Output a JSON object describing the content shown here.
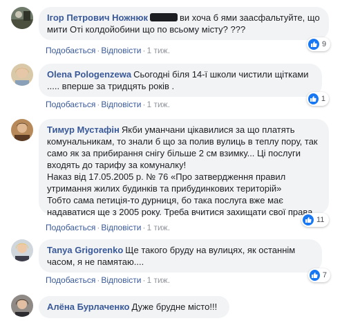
{
  "comments": [
    {
      "author": "Ігор Петрович Ножнюк",
      "text": "ви хоча б ями заасфальтуйте, що мити Оті колдойобини що по всьому місту? ???",
      "likes_count": "9",
      "action_like": "Подобається",
      "action_reply": "Відповісти",
      "time": "1 тиж."
    },
    {
      "author": "Olena Pologenzewa",
      "text": "Сьогодні біля 14-ї школи чистили щітками ..... вперше за тридцять років .",
      "likes_count": "1",
      "action_like": "Подобається",
      "action_reply": "Відповісти",
      "time": "1 тиж."
    },
    {
      "author": "Тимур Мустафін",
      "text": "Якби уманчани цікавилися за що платять комунальникам, то знали б що за полив вулиць в теплу пору, так само як за прибирання снігу більше 2 см взимку... Ці послуги входять до тарифу за комуналку!",
      "text2": "Наказ від 17.05.2005 р. № 76 «Про затвердження правил утримання жилих будинків та прибудинкових територій»",
      "text3": "Тобто сама петиція-то дурниця, бо така послуга вже має надаватися ще з 2005 року. Треба вчитися захищати свої права.",
      "likes_count": "11",
      "action_like": "Подобається",
      "action_reply": "Відповісти",
      "time": "1 тиж."
    },
    {
      "author": "Tanya Grigorenko",
      "text": "Ще такого бруду на вулицях, як останнім часом, я не памятаю....",
      "likes_count": "7",
      "action_like": "Подобається",
      "action_reply": "Відповісти",
      "time": "1 тиж."
    },
    {
      "author": "Алёна Бурлаченко",
      "text": "Дуже брудне місто!!!"
    }
  ],
  "colors": {
    "author_link": "#385898",
    "bubble_bg": "#f2f3f5",
    "like_blue": "#1877f2",
    "meta_gray": "#90949c"
  },
  "icons": {
    "like": "thumbs-up-icon",
    "avatar": "avatar"
  }
}
